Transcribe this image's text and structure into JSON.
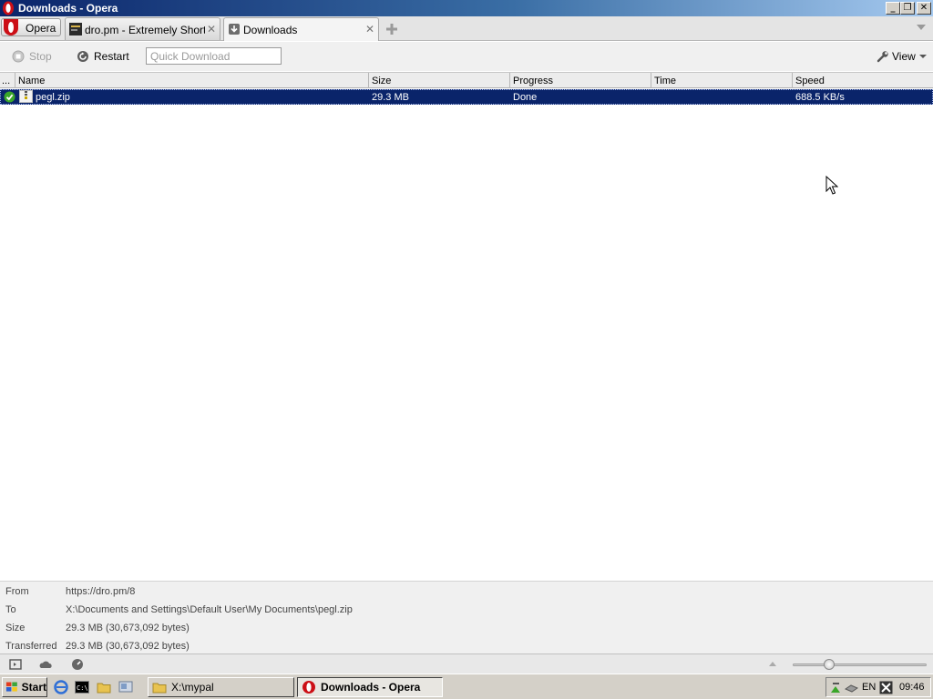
{
  "window": {
    "title": "Downloads - Opera",
    "controls": [
      "minimize",
      "maximize",
      "close"
    ]
  },
  "tabbar": {
    "menu_label": "Opera",
    "tabs": [
      {
        "label": "dro.pm - Extremely Short L...",
        "icon": "dro-favicon",
        "active": false
      },
      {
        "label": "Downloads",
        "icon": "download-icon",
        "active": true
      }
    ]
  },
  "toolbar": {
    "stop_label": "Stop",
    "restart_label": "Restart",
    "quick_download_placeholder": "Quick Download",
    "view_label": "View"
  },
  "downloads": {
    "columns": [
      "...",
      "Name",
      "Size",
      "Progress",
      "Time",
      "Speed"
    ],
    "rows": [
      {
        "status_icon": "check-icon",
        "name": "pegl.zip",
        "size": "29.3 MB",
        "progress": "Done",
        "time": "",
        "speed": "688.5 KB/s"
      }
    ]
  },
  "details": {
    "from_label": "From",
    "from_value": "https://dro.pm/8",
    "to_label": "To",
    "to_value": "X:\\Documents and Settings\\Default User\\My Documents\\pegl.zip",
    "size_label": "Size",
    "size_value": "29.3 MB (30,673,092 bytes)",
    "transferred_label": "Transferred",
    "transferred_value": "29.3 MB (30,673,092 bytes)"
  },
  "taskbar": {
    "start_label": "Start",
    "tasks": [
      {
        "label": "X:\\mypal",
        "active": false
      },
      {
        "label": "Downloads - Opera",
        "active": true
      }
    ],
    "tray": {
      "language": "EN",
      "clock": "09:46"
    }
  },
  "colors": {
    "selection": "#0a246a",
    "titlebar_start": "#0a246a",
    "titlebar_end": "#a6caf0",
    "opera_red": "#cc0f16",
    "done_green": "#3aa629"
  }
}
